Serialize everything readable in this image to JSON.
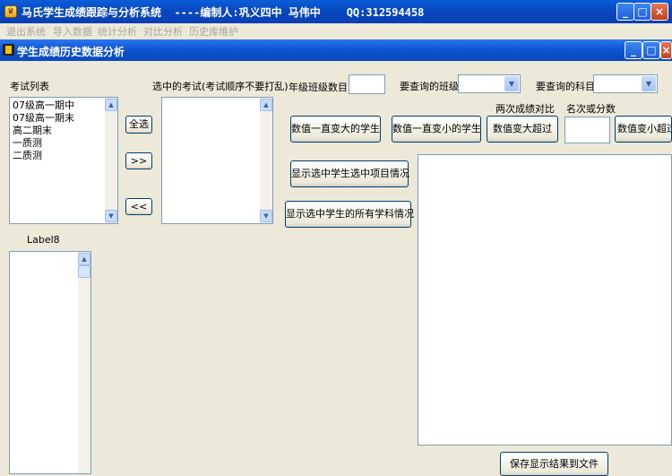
{
  "window": {
    "title": "马氏学生成绩跟踪与分析系统  ----编制人:巩义四中 马伟中    QQ:312594458",
    "buttons": {
      "minimize": "_",
      "maximize": "□",
      "close": "×"
    }
  },
  "menu": [
    "退出系统",
    "导入数据",
    "统计分析",
    "对比分析",
    "历史库维护"
  ],
  "child_window": {
    "title": "学生成绩历史数据分析"
  },
  "exam_list": {
    "label": "考试列表",
    "items": [
      "07级高一期中",
      "07级高一期末",
      "高二期末",
      "一质测",
      "二质测"
    ]
  },
  "selected_exams": {
    "label": "选中的考试(考试顺序不要打乱)",
    "items": []
  },
  "move_buttons": {
    "select_all": "全选",
    "add": ">>",
    "remove": "<<"
  },
  "label8": "Label8",
  "filters": {
    "grade_rank_label": "年级班级数目",
    "grade_rank_value": "",
    "class_label": "要查询的班级",
    "class_value": "",
    "subject_label": "要查询的科目",
    "subject_value": ""
  },
  "compare": {
    "two_exams_label": "两次成绩对比",
    "rank_or_score_label": "名次或分数",
    "rank_or_score_value": ""
  },
  "actions": {
    "always_up": "数值一直变大的学生",
    "always_down": "数值一直变小的学生",
    "up_exceed": "数值变大超过",
    "down_exceed": "数值变小超过",
    "show_selected_item": "显示选中学生选中项目情况",
    "show_all_subjects": "显示选中学生的所有学科情况",
    "save": "保存显示结果到文件"
  }
}
